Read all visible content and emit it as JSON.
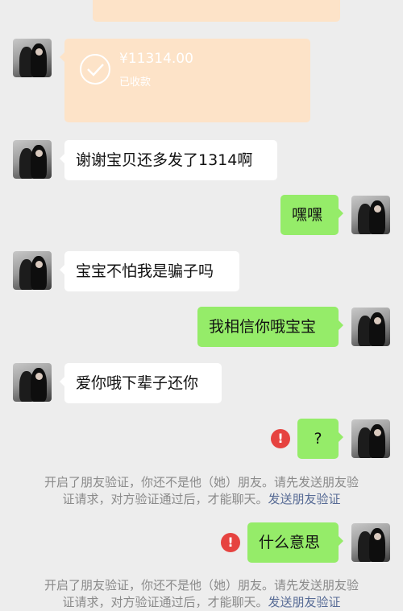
{
  "top_card": {},
  "transfer": {
    "amount": "¥11314.00",
    "status": "已收款",
    "icon": "check-icon"
  },
  "messages": [
    {
      "side": "left",
      "text": "谢谢宝贝还多发了1314啊"
    },
    {
      "side": "right",
      "text": "嘿嘿"
    },
    {
      "side": "left",
      "text": "宝宝不怕我是骗子吗"
    },
    {
      "side": "right",
      "text": "我相信你哦宝宝"
    },
    {
      "side": "left",
      "text": "爱你哦下辈子还你"
    },
    {
      "side": "right",
      "text": "?",
      "failed": true
    },
    {
      "side": "right",
      "text": "什么意思",
      "failed": true
    }
  ],
  "system_notice": {
    "line1": "开启了朋友验证，你还不是他（她）朋友。请先发送朋友验",
    "line2_prefix": "证请求，对方验证通过后，才能聊天。",
    "link": "发送朋友验证"
  },
  "colors": {
    "background": "#ededed",
    "bubble_white": "#ffffff",
    "bubble_green": "#95ec69",
    "transfer_card": "#fde3c8",
    "error": "#e64340",
    "link": "#576b95",
    "system_text": "#8a8a8a"
  }
}
